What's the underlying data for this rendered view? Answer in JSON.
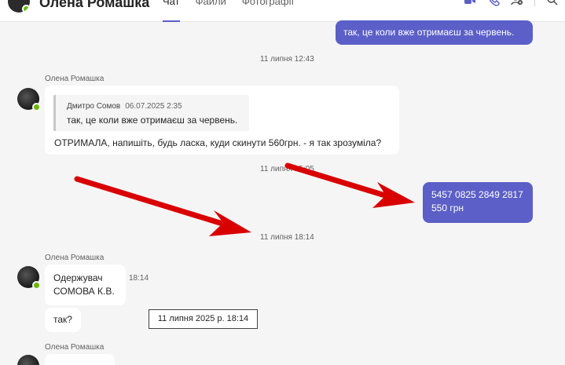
{
  "header": {
    "contact_name": "Олена Ромашка",
    "tabs": [
      {
        "label": "Чат",
        "active": true
      },
      {
        "label": "Файли",
        "active": false
      },
      {
        "label": "Фотографії",
        "active": false
      }
    ]
  },
  "messages": {
    "top_outgoing": "так, це коли вже отримаєш за червень.",
    "ts1": "11 липня 12:43",
    "sender1": "Олена Ромашка",
    "quote_author": "Дмитро Сомов",
    "quote_date": "06.07.2025 2:35",
    "quote_text": "так, це коли вже отримаєш за червень.",
    "reply_text": "ОТРИМАЛА, напишіть, будь ласка, куди скинути 560грн. - я так зрозуміла?",
    "ts2": "11 липня 15:05",
    "outgoing_line1": "5457 0825 2849 2817",
    "outgoing_line2": "550 грн",
    "ts3": "11 липня 18:14",
    "sender2": "Олена Ромашка",
    "recipient_line1": "Одержувач",
    "recipient_line2": "СОМОВА К.В.",
    "recipient_time": "18:14",
    "question": "так?",
    "tooltip": "11 липня 2025 р. 18:14",
    "sender3": "Олена Ромашка"
  },
  "colors": {
    "accent": "#5b5fc7",
    "presence": "#6bb700",
    "annotation_arrow": "#d90000"
  },
  "icons": [
    "video-call-icon",
    "phone-call-icon",
    "add-people-icon",
    "search-icon"
  ]
}
